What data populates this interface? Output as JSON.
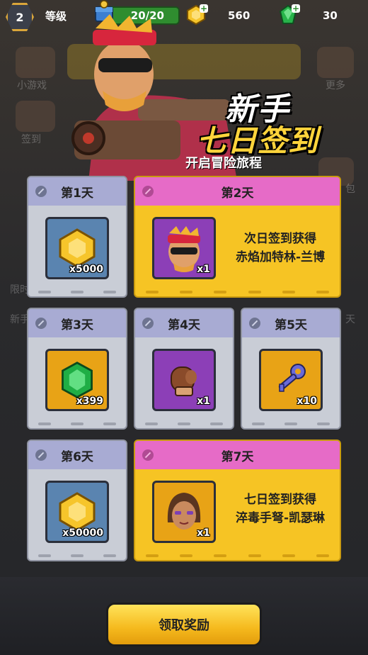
{
  "topbar": {
    "level": "2",
    "level_label": "等级",
    "energy": "20/20",
    "coins": "560",
    "gems": "30"
  },
  "header": {
    "title_line1": "新手",
    "title_line2": "七日签到",
    "subtitle": "开启冒险旅程"
  },
  "background": {
    "left_labels": [
      "小游戏",
      "签到",
      "限时",
      "新手"
    ],
    "right_labels": [
      "更多",
      "包",
      "天"
    ]
  },
  "days": [
    {
      "label": "第1天",
      "qty": "x5000",
      "item": "coin-icon"
    },
    {
      "label": "第2天",
      "qty": "x1",
      "item": "hero-portrait-rambo",
      "reward_line1": "次日签到获得",
      "reward_line2": "赤焰加特林-兰博"
    },
    {
      "label": "第3天",
      "qty": "x399",
      "item": "gem-icon"
    },
    {
      "label": "第4天",
      "qty": "x1",
      "item": "glove-icon"
    },
    {
      "label": "第5天",
      "qty": "x10",
      "item": "key-icon"
    },
    {
      "label": "第6天",
      "qty": "x50000",
      "item": "coin-icon"
    },
    {
      "label": "第7天",
      "qty": "x1",
      "item": "hero-portrait-caitlin",
      "reward_line1": "七日签到获得",
      "reward_line2": "淬毒手弩-凯瑟琳"
    }
  ],
  "claim_button": "领取奖励",
  "colors": {
    "card_gray": "#c9cdd6",
    "card_gold": "#f6c424",
    "header_lilac": "#a8abd3",
    "header_pink": "#e66bc7",
    "energy_green": "#2f8d2f",
    "title_yellow": "#ffd43b"
  }
}
